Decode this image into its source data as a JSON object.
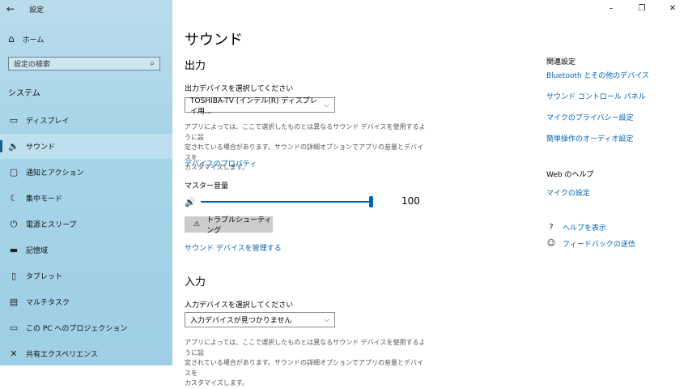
{
  "window": {
    "title": "設定",
    "controls": [
      "–",
      "❐",
      "✕"
    ]
  },
  "sidebar": {
    "back_icon": "←",
    "home_label": "ホーム",
    "home_icon": "⌂",
    "search_placeholder": "設定の検索",
    "search_icon": "⌕",
    "section_label": "システム",
    "items": [
      {
        "label": "ディスプレイ",
        "icon": "▭"
      },
      {
        "label": "サウンド",
        "icon": "🔈",
        "active": true
      },
      {
        "label": "通知とアクション",
        "icon": "▢"
      },
      {
        "label": "集中モード",
        "icon": "☾"
      },
      {
        "label": "電源とスリープ",
        "icon": "⏻"
      },
      {
        "label": "記憶域",
        "icon": "▬"
      },
      {
        "label": "タブレット",
        "icon": "▯"
      },
      {
        "label": "マルチタスク",
        "icon": "▤"
      },
      {
        "label": "この PC へのプロジェクション",
        "icon": "▭"
      },
      {
        "label": "共有エクスペリエンス",
        "icon": "✕"
      }
    ]
  },
  "main": {
    "title": "サウンド",
    "output": {
      "heading": "出力",
      "select_label": "出力デバイスを選択してください",
      "device": "TOSHIBA-TV (インテル(R) ディスプレイ用...",
      "description_lines": [
        "アプリによっては、ここで選択したものとは異なるサウンド デバイスを使用するように設",
        "定されている場合があります。サウンドの詳細オプションでアプリの音量とデバイスを",
        "カスタマイズします。"
      ],
      "device_properties_link": "デバイスのプロパティ",
      "master_volume_label": "マスター音量",
      "volume_value": "100",
      "volume_fraction": 1.0,
      "troubleshoot_label": "トラブルシューティング",
      "troubleshoot_icon": "⚠",
      "manage_devices_link": "サウンド デバイスを管理する"
    },
    "input": {
      "heading": "入力",
      "select_label": "入力デバイスを選択してください",
      "device": "入力デバイスが見つかりません",
      "description_lines": [
        "アプリによっては、ここで選択したものとは異なるサウンド デバイスを使用するように設",
        "定されている場合があります。サウンドの詳細オプションでアプリの音量とデバイスを",
        "カスタマイズします。"
      ]
    }
  },
  "related": {
    "heading": "関連設定",
    "links": [
      "Bluetooth とその他のデバイス",
      "サウンド コントロール パネル",
      "マイクのプライバシー設定",
      "簡単操作のオーディオ設定"
    ],
    "web_help_heading": "Web のヘルプ",
    "web_help_link": "マイクの設定",
    "help": {
      "label": "ヘルプを表示",
      "icon": "?"
    },
    "feedback": {
      "label": "フィードバックの送信",
      "icon": "☺"
    }
  }
}
